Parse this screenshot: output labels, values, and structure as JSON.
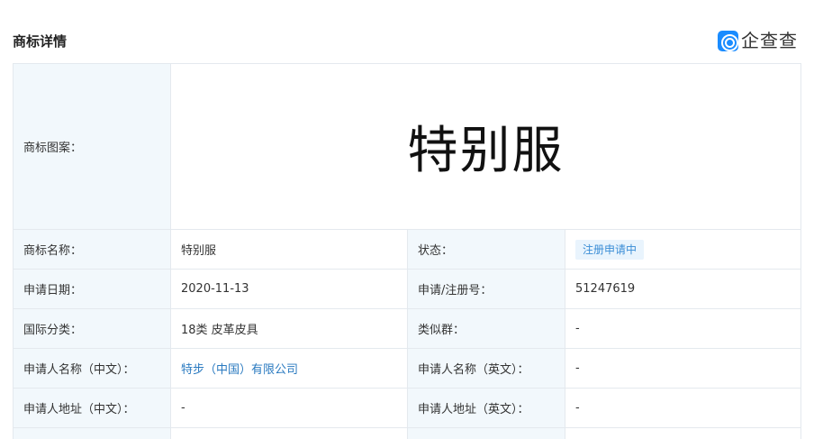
{
  "header": {
    "title": "商标详情",
    "logo_text": "企查查",
    "logo_icon": "qichacha-logo-icon"
  },
  "trademark": {
    "image_label": "商标图案：",
    "image_text": "特别服",
    "rows": [
      {
        "l1": "商标名称：",
        "v1": "特别服",
        "l2": "状态：",
        "v2": "注册申请中"
      },
      {
        "l1": "申请日期：",
        "v1": "2020-11-13",
        "l2": "申请/注册号：",
        "v2": "51247619"
      },
      {
        "l1": "国际分类：",
        "v1": "18类 皮革皮具",
        "l2": "类似群：",
        "v2": "-"
      },
      {
        "l1": "申请人名称（中文）：",
        "v1": "特步（中国）有限公司",
        "l2": "申请人名称（英文）：",
        "v2": "-"
      },
      {
        "l1": "申请人地址（中文）：",
        "v1": "-",
        "l2": "申请人地址（英文）：",
        "v2": "-"
      }
    ]
  },
  "colors": {
    "label_bg": "#f2f8fc",
    "border": "#e4e9ee",
    "status_badge_bg": "#e9f4fd",
    "status_badge_text": "#3a8dd6",
    "link": "#2a7ac0",
    "brand_blue": "#1a8cff"
  }
}
